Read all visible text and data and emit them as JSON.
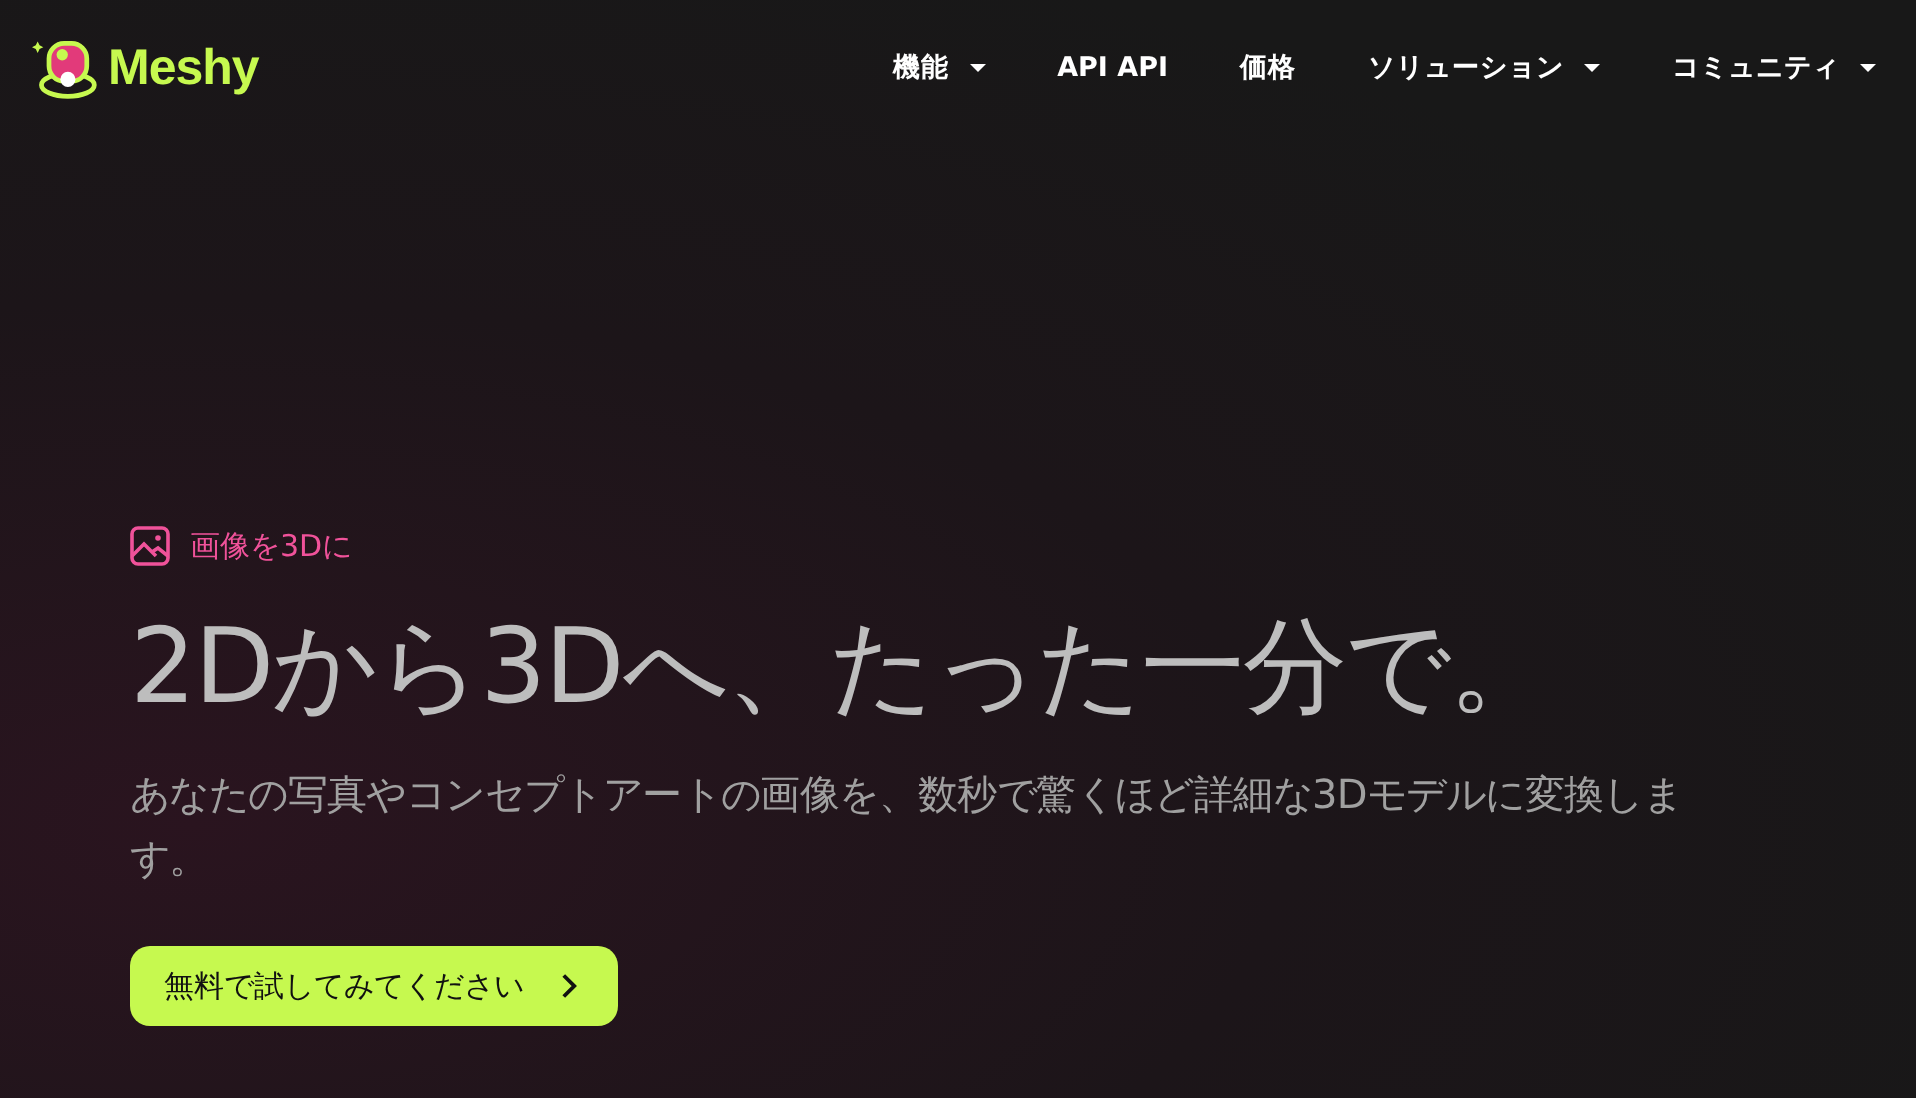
{
  "header": {
    "logo_text": "Meshy",
    "nav": [
      {
        "label": "機能",
        "has_menu": true
      },
      {
        "label": "API API",
        "has_menu": false
      },
      {
        "label": "価格",
        "has_menu": false
      },
      {
        "label": "ソリューション",
        "has_menu": true
      },
      {
        "label": "コミュニティ",
        "has_menu": true
      }
    ]
  },
  "hero": {
    "badge": "画像を3Dに",
    "heading": "2Dから3Dへ、たった一分で。",
    "description": "あなたの写真やコンセプトアートの画像を、数秒で驚くほど詳細な3Dモデルに変換します。",
    "cta": "無料で試してみてください"
  }
}
